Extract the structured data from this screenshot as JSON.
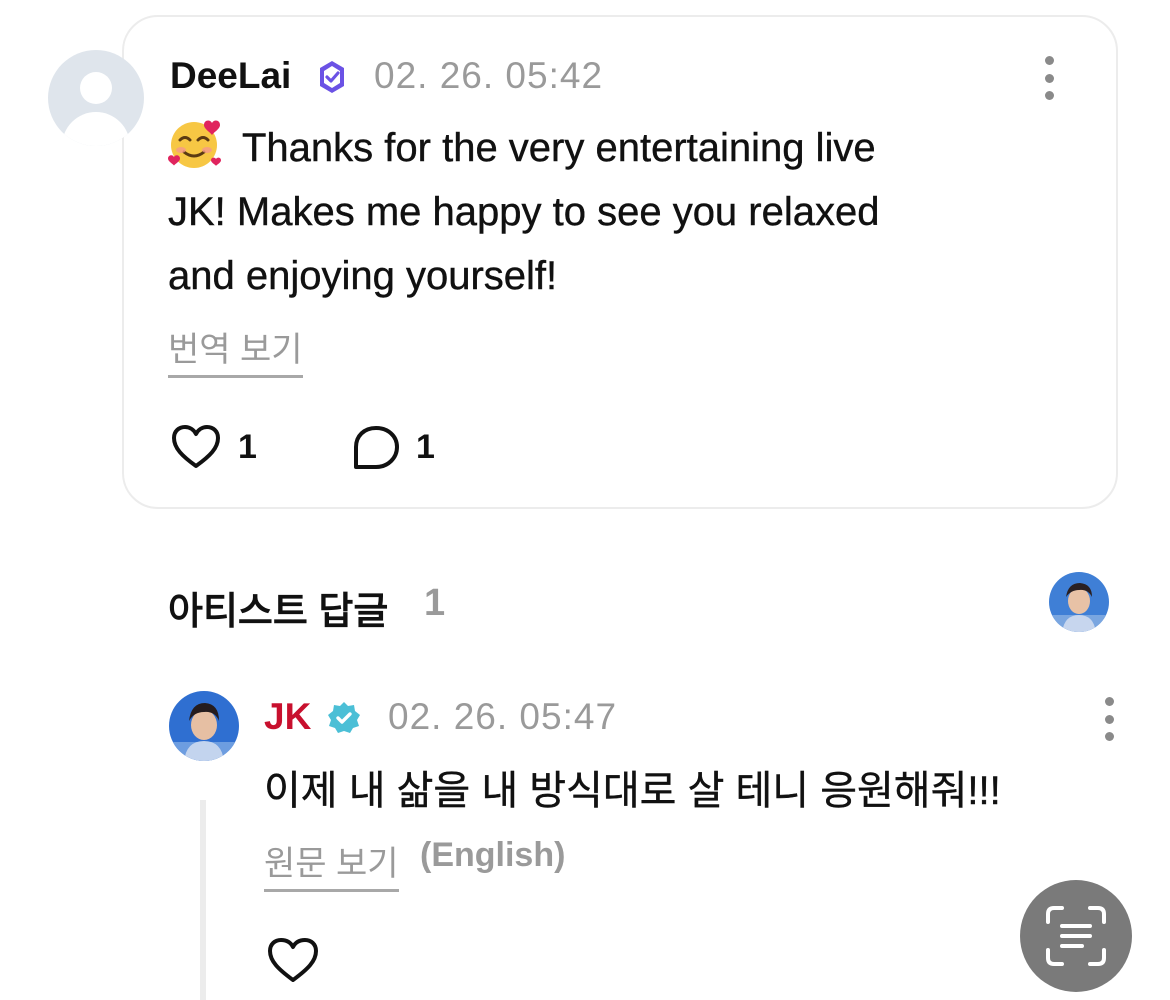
{
  "comment": {
    "author": "DeeLai",
    "timestamp": "02. 26. 05:42",
    "text_line1": "Thanks for the very entertaining live",
    "text_line2": "JK!  Makes me happy to see you relaxed",
    "text_line3": "and enjoying yourself!",
    "translate_label": "번역 보기",
    "like_count": "1",
    "reply_count": "1"
  },
  "artist_replies": {
    "title": "아티스트 답글",
    "count": "1"
  },
  "reply": {
    "author": "JK",
    "timestamp": "02. 26. 05:47",
    "text": "이제 내 삶을 내 방식대로 살 테니 응원해줘!!!",
    "original_label": "원문 보기",
    "original_lang": "(English)"
  },
  "colors": {
    "verified_purple": "#6b52e5",
    "verified_teal": "#4bbfd6",
    "artist_red": "#c8102e",
    "muted_gray": "#9a9a9a"
  },
  "icons": [
    "verified-badge-icon",
    "more-vert-icon",
    "heart-icon",
    "comment-icon",
    "scan-text-icon"
  ]
}
